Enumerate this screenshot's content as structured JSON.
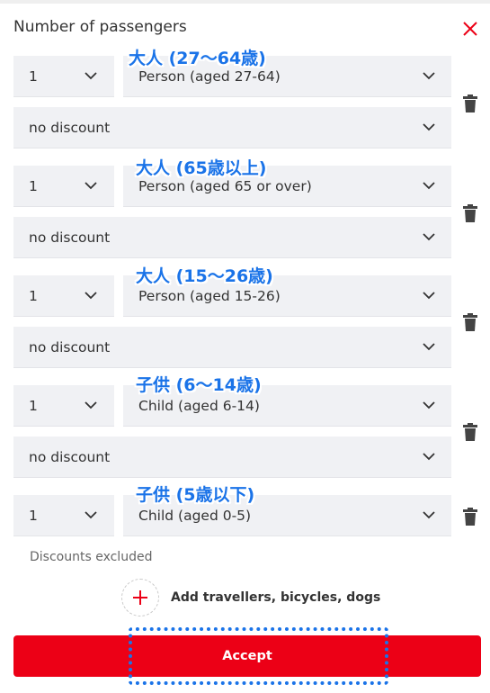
{
  "header": {
    "title": "Number of passengers",
    "close_icon": "close-icon",
    "accent": "#ec0016"
  },
  "groups": [
    {
      "annotation": "大人 (27〜64歳)",
      "quantity": "1",
      "type": "Person (aged 27-64)",
      "discount": "no discount"
    },
    {
      "annotation": "大人 (65歳以上)",
      "quantity": "1",
      "type": "Person (aged 65 or over)",
      "discount": "no discount"
    },
    {
      "annotation": "大人 (15〜26歳)",
      "quantity": "1",
      "type": "Person (aged 15-26)",
      "discount": "no discount"
    },
    {
      "annotation": "子供 (6〜14歳)",
      "quantity": "1",
      "type": "Child (aged 6-14)",
      "discount": "no discount"
    },
    {
      "annotation": "子供 (5歳以下)",
      "quantity": "1",
      "type": "Child (aged 0-5)",
      "note": "Discounts excluded"
    }
  ],
  "add_button": {
    "label": "Add travellers, bicycles, dogs",
    "icon": "plus-icon"
  },
  "accept_button": {
    "label": "Accept",
    "color": "#ec0016"
  },
  "annotation_color": "#1a73e8"
}
